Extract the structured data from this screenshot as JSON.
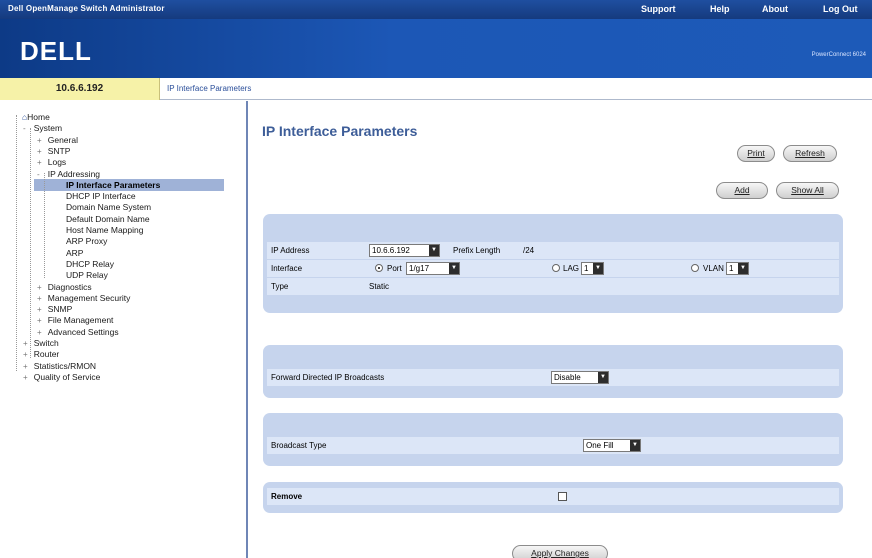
{
  "topbar": {
    "app_title": "Dell OpenManage Switch Administrator",
    "support": "Support",
    "help": "Help",
    "about": "About",
    "logout": "Log Out"
  },
  "logo": {
    "text": "DELL",
    "product": "PowerConnect 6024"
  },
  "ipbar": {
    "ip": "10.6.6.192",
    "breadcrumb": "IP Interface Parameters"
  },
  "tree": {
    "items": [
      {
        "label": "Home",
        "level": 0,
        "toggle": ""
      },
      {
        "label": "System",
        "level": 1,
        "toggle": "-"
      },
      {
        "label": "General",
        "level": 2,
        "toggle": "+"
      },
      {
        "label": "SNTP",
        "level": 2,
        "toggle": "+"
      },
      {
        "label": "Logs",
        "level": 2,
        "toggle": "+"
      },
      {
        "label": "IP Addressing",
        "level": 2,
        "toggle": "-"
      },
      {
        "label": "IP Interface Parameters",
        "level": 3,
        "toggle": "",
        "selected": true
      },
      {
        "label": "DHCP IP Interface",
        "level": 3,
        "toggle": ""
      },
      {
        "label": "Domain Name System",
        "level": 3,
        "toggle": ""
      },
      {
        "label": "Default Domain Name",
        "level": 3,
        "toggle": ""
      },
      {
        "label": "Host Name Mapping",
        "level": 3,
        "toggle": ""
      },
      {
        "label": "ARP Proxy",
        "level": 3,
        "toggle": ""
      },
      {
        "label": "ARP",
        "level": 3,
        "toggle": ""
      },
      {
        "label": "DHCP Relay",
        "level": 3,
        "toggle": ""
      },
      {
        "label": "UDP Relay",
        "level": 3,
        "toggle": ""
      },
      {
        "label": "Diagnostics",
        "level": 2,
        "toggle": "+"
      },
      {
        "label": "Management Security",
        "level": 2,
        "toggle": "+"
      },
      {
        "label": "SNMP",
        "level": 2,
        "toggle": "+"
      },
      {
        "label": "File Management",
        "level": 2,
        "toggle": "+"
      },
      {
        "label": "Advanced Settings",
        "level": 2,
        "toggle": "+"
      },
      {
        "label": "Switch",
        "level": 1,
        "toggle": "+"
      },
      {
        "label": "Router",
        "level": 1,
        "toggle": "+"
      },
      {
        "label": "Statistics/RMON",
        "level": 1,
        "toggle": "+"
      },
      {
        "label": "Quality of Service",
        "level": 1,
        "toggle": "+"
      }
    ]
  },
  "main": {
    "title": "IP Interface Parameters",
    "buttons": {
      "print": "Print",
      "refresh": "Refresh",
      "add": "Add",
      "show_all": "Show All",
      "apply": "Apply Changes"
    },
    "ip_panel": {
      "ip_address_label": "IP Address",
      "ip_address_value": "10.6.6.192",
      "prefix_length_label": "Prefix Length",
      "prefix_length_value": "/24",
      "interface_label": "Interface",
      "port_label": "Port",
      "port_value": "1/g17",
      "lag_label": "LAG",
      "lag_value": "1",
      "vlan_label": "VLAN",
      "vlan_value": "1",
      "type_label": "Type",
      "type_value": "Static"
    },
    "forward_panel": {
      "label": "Forward Directed IP Broadcasts",
      "value": "Disable"
    },
    "broadcast_panel": {
      "label": "Broadcast Type",
      "value": "One Fill"
    },
    "remove_panel": {
      "label": "Remove"
    }
  },
  "colors": {
    "accent": "#1d5ab8",
    "panel": "#c6d4ed",
    "row": "#dce6f7",
    "title": "#3d5d98",
    "ipbox": "#f6f2a8"
  }
}
